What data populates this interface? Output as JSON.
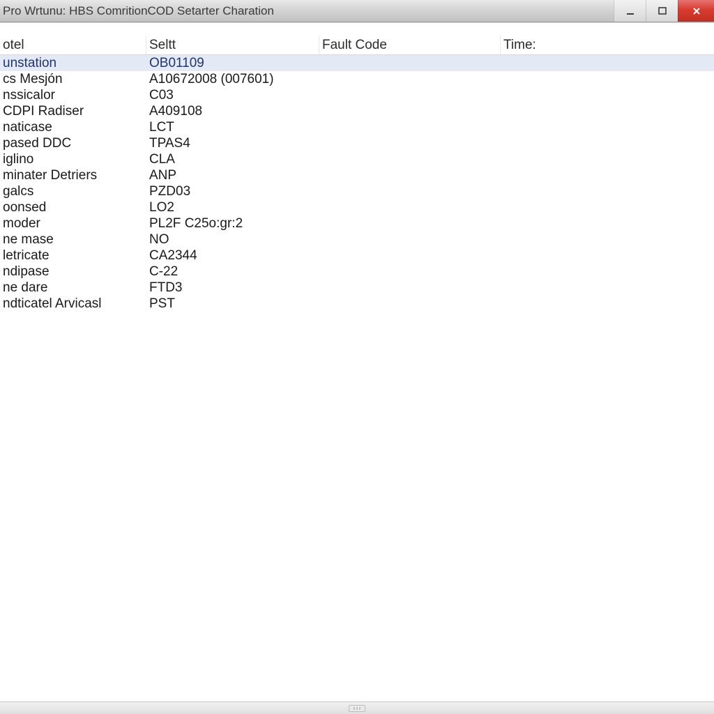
{
  "window": {
    "title": "Pro Wrtunu: HBS ComritionCOD Setarter Charation"
  },
  "columns": [
    {
      "label": "otel"
    },
    {
      "label": "Seltt"
    },
    {
      "label": "Fault Code"
    },
    {
      "label": "Time:"
    }
  ],
  "rows": [
    {
      "c0": "unstation",
      "c1": "OB01109",
      "c2": "",
      "c3": "",
      "selected": true
    },
    {
      "c0": "cs Mesjón",
      "c1": "A10672008 (007601)",
      "c2": "",
      "c3": "",
      "selected": false
    },
    {
      "c0": "nssicalor",
      "c1": "C03",
      "c2": "",
      "c3": "",
      "selected": false
    },
    {
      "c0": "CDPI Radiser",
      "c1": "A409108",
      "c2": "",
      "c3": "",
      "selected": false
    },
    {
      "c0": "naticase",
      "c1": "LCT",
      "c2": "",
      "c3": "",
      "selected": false
    },
    {
      "c0": "pased DDC",
      "c1": "TPAS4",
      "c2": "",
      "c3": "",
      "selected": false
    },
    {
      "c0": "iglino",
      "c1": "CLA",
      "c2": "",
      "c3": "",
      "selected": false
    },
    {
      "c0": "minater Detriers",
      "c1": "ANP",
      "c2": "",
      "c3": "",
      "selected": false
    },
    {
      "c0": "galcs",
      "c1": "PZD03",
      "c2": "",
      "c3": "",
      "selected": false
    },
    {
      "c0": "oonsed",
      "c1": "LO2",
      "c2": "",
      "c3": "",
      "selected": false
    },
    {
      "c0": "moder",
      "c1": "PL2F C25o:gr:2",
      "c2": "",
      "c3": "",
      "selected": false
    },
    {
      "c0": "ne mase",
      "c1": "NO",
      "c2": "",
      "c3": "",
      "selected": false
    },
    {
      "c0": "letricate",
      "c1": "CA2344",
      "c2": "",
      "c3": "",
      "selected": false
    },
    {
      "c0": "ndipase",
      "c1": "C-22",
      "c2": "",
      "c3": "",
      "selected": false
    },
    {
      "c0": "ne dare",
      "c1": "FTD3",
      "c2": "",
      "c3": "",
      "selected": false
    },
    {
      "c0": "ndticatel Arvicasl",
      "c1": "PST",
      "c2": "",
      "c3": "",
      "selected": false
    }
  ],
  "colors": {
    "rowSelected": "#e3e9f5",
    "closeBtn": "#d93b2e"
  }
}
